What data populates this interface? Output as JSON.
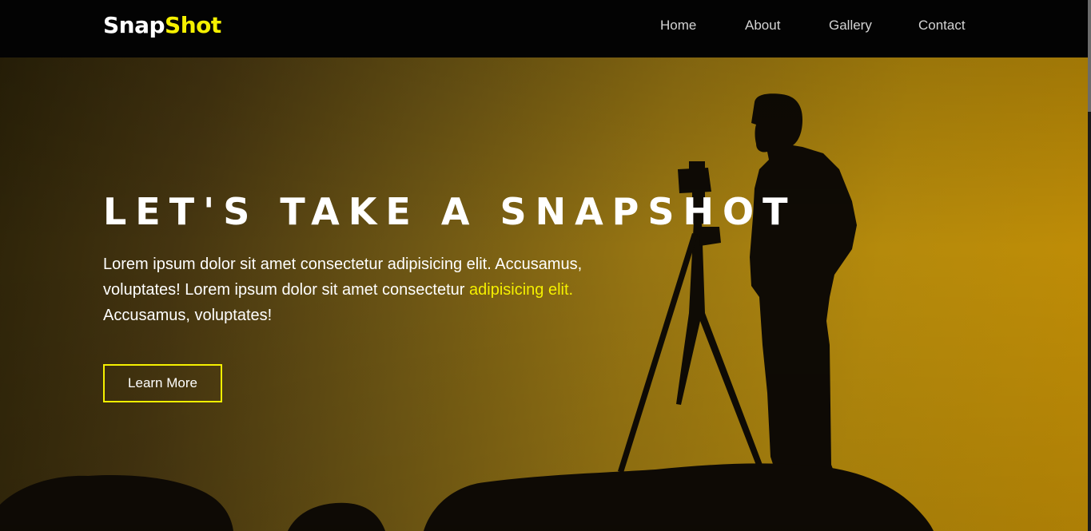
{
  "brand": {
    "part1": "Snap",
    "part2": "Shot"
  },
  "nav": {
    "home": "Home",
    "about": "About",
    "gallery": "Gallery",
    "contact": "Contact"
  },
  "hero": {
    "title": "LET'S TAKE A SNAPSHOT",
    "text_before": "Lorem ipsum dolor sit amet consectetur adipisicing elit. Accusamus, voluptates! Lorem ipsum dolor sit amet consectetur ",
    "text_highlight": "adipisicing elit.",
    "text_after": " Accusamus, voluptates!",
    "button": "Learn More"
  },
  "colors": {
    "accent": "#f5f000",
    "navbar": "#030303",
    "hero_dark": "#2b2208",
    "hero_light": "#c18d05"
  }
}
